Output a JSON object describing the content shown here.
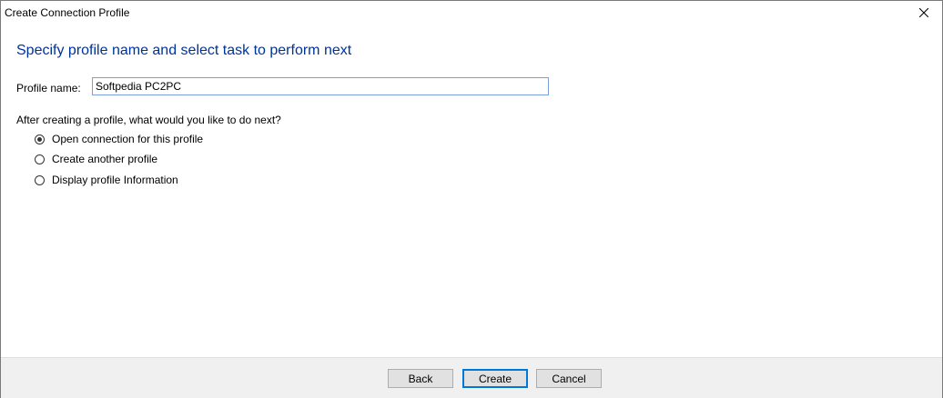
{
  "window": {
    "title": "Create Connection Profile"
  },
  "main": {
    "heading": "Specify profile name and select task to perform next",
    "profile_name_label": "Profile name:",
    "profile_name_value": "Softpedia PC2PC",
    "question": "After creating a profile, what would you like to do next?",
    "options": [
      {
        "label": "Open connection for this profile",
        "checked": true
      },
      {
        "label": "Create another profile",
        "checked": false
      },
      {
        "label": "Display profile Information",
        "checked": false
      }
    ]
  },
  "footer": {
    "back_label": "Back",
    "create_label": "Create",
    "cancel_label": "Cancel"
  },
  "colors": {
    "heading": "#003399",
    "default_button_border": "#0078d7",
    "footer_bg": "#f0f0f0"
  }
}
